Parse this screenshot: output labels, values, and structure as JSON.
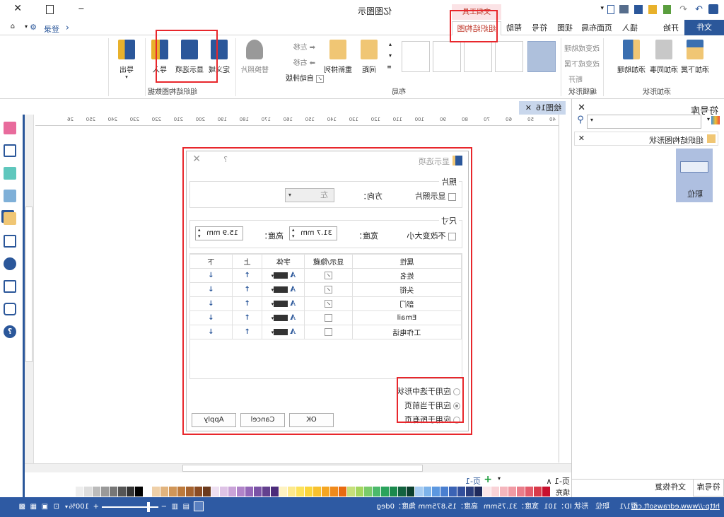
{
  "app": {
    "title": "亿图图示",
    "login": "登录",
    "window_controls": [
      "minimize",
      "restore",
      "close"
    ]
  },
  "tabs": {
    "file": "文件",
    "items": [
      "开始",
      "插入",
      "页面布局",
      "视图",
      "符号",
      "帮助"
    ],
    "context_group": "文档工具",
    "context_tab": "组织结构图"
  },
  "ribbon": {
    "add_shape": {
      "label": "添加形状",
      "buttons": [
        "添加下属",
        "添加同事",
        "添加助理"
      ]
    },
    "edit_shape": {
      "label": "编辑形状",
      "buttons": [
        "改变成助理",
        "改变成下属",
        "断开"
      ]
    },
    "layout": {
      "label": "布局",
      "spacing": "间距",
      "rearrange": "重新排列",
      "move_left": "左移",
      "move_right": "右移",
      "auto_layout": "自动排版",
      "replace_photo": "替换照片"
    },
    "data": {
      "label": "组织结构图数据",
      "buttons": [
        "导出",
        "导入",
        "显示选项",
        "定义域"
      ]
    }
  },
  "document": {
    "tab": "绘图16",
    "ruler": [
      "40",
      "50",
      "60",
      "70",
      "80",
      "90",
      "100",
      "110",
      "120",
      "130",
      "140",
      "150",
      "160",
      "170",
      "180",
      "190",
      "200",
      "210",
      "220",
      "230",
      "240",
      "250",
      "26"
    ]
  },
  "library": {
    "title": "符号库",
    "category": "组织结构图形状",
    "shape": "职位",
    "bottom_tabs": [
      "符号库",
      "文件恢复"
    ]
  },
  "dialog": {
    "title": "显示选项",
    "help": "?",
    "photo": {
      "legend": "照片",
      "show_photo": "显示照片",
      "direction_label": "方向：",
      "direction_value": "左"
    },
    "size": {
      "legend": "尺寸",
      "keep_size": "不改变大小",
      "width_label": "宽度：",
      "width_value": "31.7 mm",
      "height_label": "高度：",
      "height_value": "15.9 mm"
    },
    "columns": [
      "属性",
      "显示/隐藏",
      "字体",
      "上",
      "下"
    ],
    "rows": [
      {
        "name": "姓名",
        "visible": true
      },
      {
        "name": "头衔",
        "visible": true
      },
      {
        "name": "部门",
        "visible": true
      },
      {
        "name": "Email",
        "visible": false
      },
      {
        "name": "工作电话",
        "visible": false
      }
    ],
    "apply_options": [
      "应用于选中形状",
      "应用于当前页",
      "应用于所有页"
    ],
    "apply_selected": 1,
    "buttons": {
      "ok": "OK",
      "cancel": "Cancel",
      "apply": "Apply"
    }
  },
  "pages": {
    "current": "页-1",
    "tab": "页-1"
  },
  "palette": {
    "label": "填充",
    "colors": [
      "#c8102e",
      "#d93a4a",
      "#e45b6b",
      "#ea7d8a",
      "#f19aa4",
      "#f5b6bd",
      "#f9d3d7",
      "#fbe6e9",
      "#1f2a5c",
      "#2a3d7c",
      "#324f9c",
      "#3b63b5",
      "#4a7fd0",
      "#5c98e0",
      "#7db3ea",
      "#a6ccf2",
      "#0c3f2e",
      "#13623f",
      "#1b8a4d",
      "#2aa35c",
      "#4cb96b",
      "#7acb6a",
      "#a4d65e",
      "#c6e07a",
      "#e86a10",
      "#f08a1c",
      "#f5a623",
      "#f8c12e",
      "#fbd53a",
      "#fde25a",
      "#fde98b",
      "#fef3c2",
      "#4b2b7a",
      "#63408e",
      "#7a52a6",
      "#9467b8",
      "#b084c9",
      "#c9a3d8",
      "#dec3e6",
      "#eee0f2",
      "#6b3a1c",
      "#8a4b22",
      "#a5622e",
      "#bd7a3c",
      "#d19658",
      "#e2b47e",
      "#efd0a8",
      "#ffffff",
      "#000000",
      "#333333",
      "#555555",
      "#777777",
      "#999999",
      "#bbbbbb",
      "#dddddd",
      "#eeeeee"
    ]
  },
  "status": {
    "url": "http://www.edrawsoft.cn/",
    "page": "页1/1",
    "shape": "职位",
    "shape_id": "形状 ID：101",
    "width": "宽度：31.75mm",
    "height": "高度：15.875mm",
    "angle": "角度：0deg",
    "zoom": "100%"
  },
  "colors": {
    "accent": "#2b579a",
    "highlight": "#e8272c",
    "selected_layout": "#aec0dc"
  }
}
